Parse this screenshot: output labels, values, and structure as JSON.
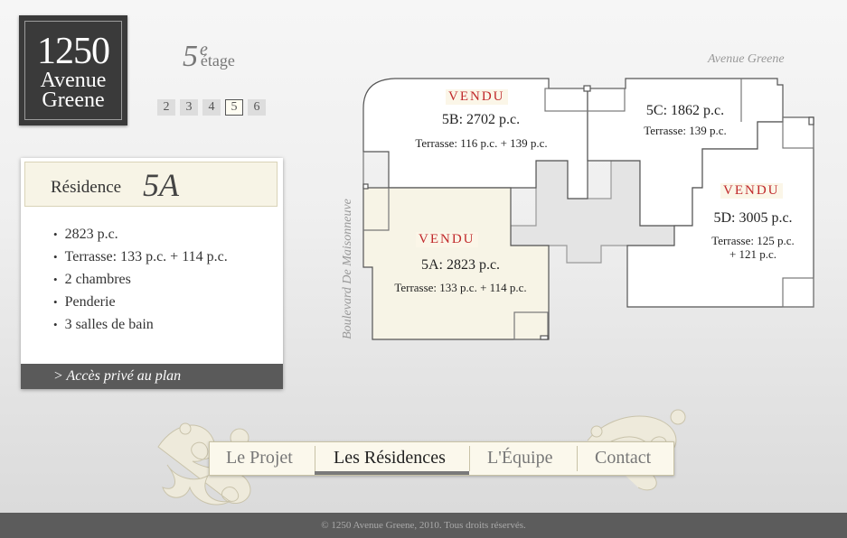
{
  "logo": {
    "number": "1250",
    "line1": "Avenue",
    "line2": "Greene"
  },
  "floor": {
    "number": "5",
    "sup": "e",
    "word": "étage"
  },
  "floor_selector": [
    "2",
    "3",
    "4",
    "5",
    "6"
  ],
  "residence": {
    "label": "Résidence",
    "unit": "5A",
    "features": [
      "2823 p.c.",
      "Terrasse: 133 p.c. + 114 p.c.",
      "2 chambres",
      "Penderie",
      "3 salles de bain"
    ],
    "access_link": "> Accès privé au plan"
  },
  "streets": {
    "top": "Avenue Greene",
    "side": "Boulevard De Maisonneuve"
  },
  "units": [
    {
      "id": "5B",
      "sold": "VENDU",
      "area": "5B: 2702 p.c.",
      "terrace": "Terrasse: 116 p.c. + 139 p.c."
    },
    {
      "id": "5C",
      "area": "5C: 1862 p.c.",
      "terrace": "Terrasse: 139 p.c."
    },
    {
      "id": "5D",
      "sold": "VENDU",
      "area": "5D: 3005 p.c.",
      "terrace": "Terrasse: 125 p.c.",
      "terrace2": "+ 121 p.c."
    },
    {
      "id": "5A",
      "sold": "VENDU",
      "area": "5A: 2823 p.c.",
      "terrace": "Terrasse: 133 p.c. + 114 p.c."
    }
  ],
  "nav": [
    "Le Projet",
    "Les Résidences",
    "L'Équipe",
    "Contact"
  ],
  "footer": "© 1250 Avenue Greene, 2010. Tous droits réservés.",
  "colors": {
    "sold": "#c0282a",
    "selected_unit": "#f7f4e6",
    "dark": "#3a3a3a"
  }
}
